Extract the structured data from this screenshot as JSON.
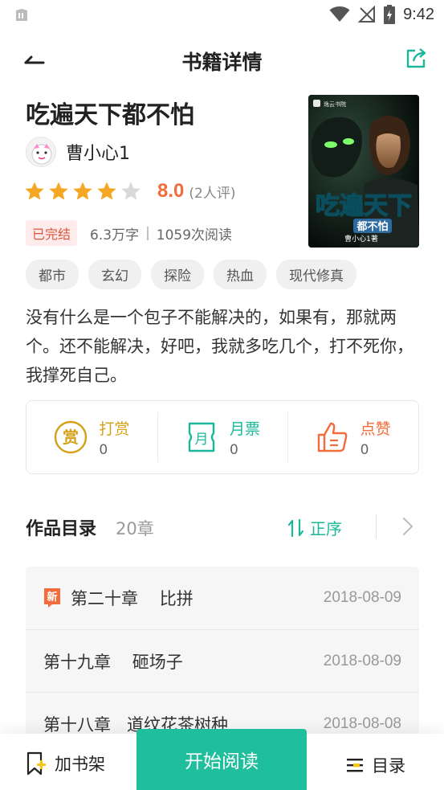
{
  "status_bar": {
    "time": "9:42"
  },
  "app_bar": {
    "title": "书籍详情"
  },
  "book": {
    "title": "吃遍天下都不怕",
    "author": "曹小心1",
    "rating": {
      "stars_filled": 4,
      "stars_total": 5,
      "score": "8.0",
      "review_count": "(2人评)"
    },
    "status": "已完结",
    "word_count": "6.3万字",
    "separator": "|",
    "reads": "1059次阅读",
    "tags": [
      "都市",
      "玄幻",
      "探险",
      "热血",
      "现代修真"
    ],
    "intro": "没有什么是一个包子不能解决的，如果有，那就两个。还不能解决，好吧，我就多吃几个，打不死你，我撑死自己。",
    "cover": {
      "publisher": "逸云书院",
      "title_line1": "吃遍天下",
      "title_line2": "都不怕",
      "author": "曹小心1著"
    }
  },
  "actions": [
    {
      "icon": "reward-icon",
      "label": "打赏",
      "count": "0",
      "color": "#d4a017"
    },
    {
      "icon": "ticket-icon",
      "label": "月票",
      "count": "0",
      "color": "#19b89a"
    },
    {
      "icon": "thumbs-up-icon",
      "label": "点赞",
      "count": "0",
      "color": "#f26b3a"
    }
  ],
  "toc": {
    "title": "作品目录",
    "count": "20章",
    "sort_label": "正序",
    "chapters": [
      {
        "name": "第二十章    比拼",
        "date": "2018-08-09",
        "is_new": true,
        "new_label": "新"
      },
      {
        "name": "第十九章    砸场子",
        "date": "2018-08-09",
        "is_new": false
      },
      {
        "name": "第十八章   道纹花茶树种",
        "date": "2018-08-08",
        "is_new": false
      }
    ]
  },
  "bottom_bar": {
    "add_shelf": "加书架",
    "start_reading": "开始阅读",
    "toc": "目录"
  },
  "colors": {
    "accent": "#1fbf9d",
    "score": "#f26b3a",
    "star": "#f5a623",
    "star_empty": "#d9d9d9"
  }
}
